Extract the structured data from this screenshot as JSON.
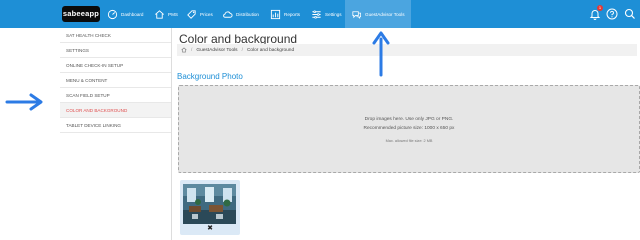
{
  "app": {
    "logo_text": "sabeeapp"
  },
  "nav": {
    "items": [
      {
        "label": "Dashboard",
        "icon": "dashboard-icon"
      },
      {
        "label": "PMS",
        "icon": "house-icon"
      },
      {
        "label": "Prices",
        "icon": "tag-icon"
      },
      {
        "label": "Distribution",
        "icon": "cloud-icon"
      },
      {
        "label": "Reports",
        "icon": "chart-icon"
      },
      {
        "label": "Settings",
        "icon": "sliders-icon"
      },
      {
        "label": "GuestAdvisor Tools",
        "icon": "chat-icon"
      }
    ],
    "notification_count": "1"
  },
  "sidebar": {
    "items": [
      {
        "label": "SAT HEALTH CHECK"
      },
      {
        "label": "SETTINGS"
      },
      {
        "label": "ONLINE CHECK-IN SETUP"
      },
      {
        "label": "MENU & CONTENT"
      },
      {
        "label": "SCAN FIELD SETUP"
      },
      {
        "label": "COLOR AND BACKGROUND"
      },
      {
        "label": "TABLET DEVICE LINKING"
      }
    ]
  },
  "main": {
    "title": "Color and background",
    "breadcrumbs": [
      "GuestAdvisor Tools",
      "Color and background"
    ],
    "section_title": "Background Photo",
    "dropzone": {
      "line1": "Drop images here. Use only JPG or PNG.",
      "line2": "Recommended picture size: 1000 x 650 px",
      "line3": "Max. allowed file size: 2 MB"
    },
    "thumbnail": {
      "delete_label": "✖"
    }
  },
  "colors": {
    "nav_bg": "#1e8fd6",
    "nav_active": "#4ba5e0",
    "accent": "#1e8fd6",
    "active_sidebar_text": "#e05050",
    "annotation_arrow": "#2c7be5"
  }
}
